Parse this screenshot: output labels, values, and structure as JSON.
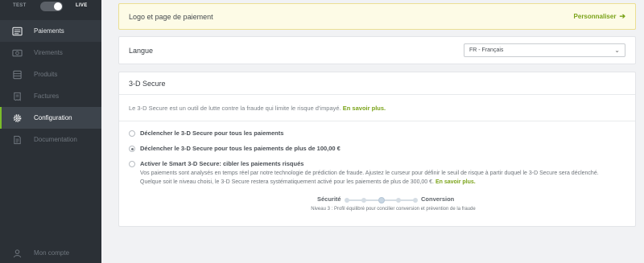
{
  "sidebar": {
    "mode": {
      "test_label": "TEST",
      "live_label": "LIVE"
    },
    "items": [
      {
        "label": "Paiements",
        "icon": "list-icon",
        "state": "enabled"
      },
      {
        "label": "Virements",
        "icon": "banknote-icon",
        "state": "disabled"
      },
      {
        "label": "Produits",
        "icon": "box-icon",
        "state": "disabled"
      },
      {
        "label": "Factures",
        "icon": "invoice-icon",
        "state": "disabled"
      },
      {
        "label": "Configuration",
        "icon": "gear-icon",
        "state": "active"
      },
      {
        "label": "Documentation",
        "icon": "document-icon",
        "state": "disabled"
      }
    ],
    "account_label": "Mon compte"
  },
  "banner": {
    "title": "Logo et page de paiement",
    "link": "Personnaliser",
    "link_icon": "arrow-right-icon"
  },
  "language": {
    "label": "Langue",
    "selected": "FR - Français"
  },
  "secure": {
    "title": "3-D Secure",
    "intro": "Le 3-D Secure est un outil de lutte contre la fraude qui limite le risque d'impayé.",
    "intro_link": "En savoir plus.",
    "options": [
      {
        "label": "Déclencher le 3-D Secure pour tous les paiements",
        "checked": false
      },
      {
        "label": "Déclencher le 3-D Secure pour tous les paiements de plus de 100,00 €",
        "checked": true
      },
      {
        "label": "Activer le Smart 3-D Secure: cibler les paiements risqués",
        "checked": false
      }
    ],
    "smart_desc": "Vos paiements sont analysés en temps réel par notre technologie de prédiction de fraude. Ajustez le curseur pour définir le seuil de risque à partir duquel le 3-D Secure sera déclenché. Quelque soit le niveau choisi, le 3-D Secure restera systématiquement activé pour les paiements de plus de 300,00 €.",
    "smart_link": "En savoir plus.",
    "slider": {
      "left_label": "Sécurité",
      "right_label": "Conversion",
      "level": 3,
      "levels": 5,
      "caption": "Niveau 3 : Profil équilibré pour concilier conversion et prévention de la fraude"
    }
  },
  "colors": {
    "sidebar_bg": "#2b3036",
    "accent": "#7bbd2a",
    "link": "#7aa319",
    "banner_bg": "#fdfbe6",
    "banner_border": "#ebdf93"
  }
}
